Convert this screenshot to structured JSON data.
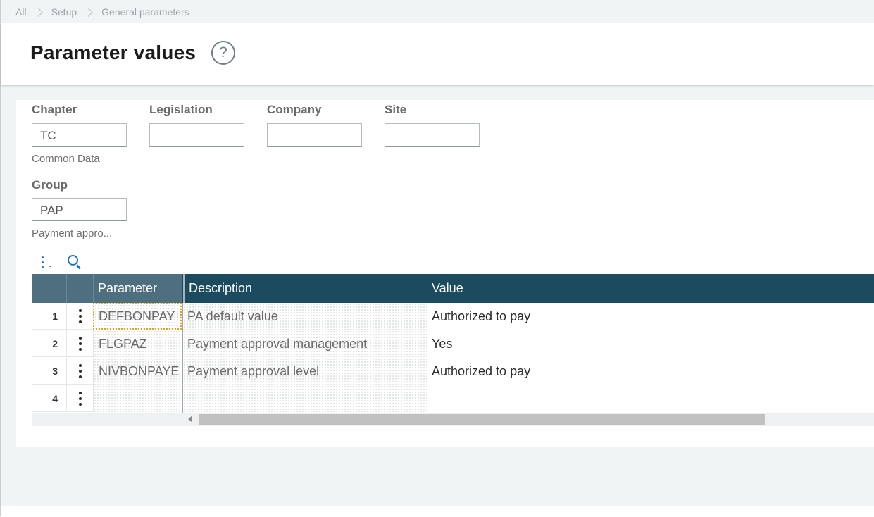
{
  "breadcrumb": {
    "items": [
      "All",
      "Setup",
      "General parameters"
    ]
  },
  "header": {
    "title": "Parameter values",
    "help_icon": "help-circle-icon",
    "help_glyph": "?"
  },
  "filters": {
    "chapter": {
      "label": "Chapter",
      "value": "TC",
      "hint": "Common Data"
    },
    "legislation": {
      "label": "Legislation",
      "value": ""
    },
    "company": {
      "label": "Company",
      "value": ""
    },
    "site": {
      "label": "Site",
      "value": ""
    },
    "group": {
      "label": "Group",
      "value": "PAP",
      "hint": "Payment appro..."
    }
  },
  "toolbar": {
    "icons": [
      "more-vertical-icon",
      "search-icon"
    ]
  },
  "grid": {
    "columns": [
      "Parameter",
      "Description",
      "Value"
    ],
    "rows": [
      {
        "num": "1",
        "parameter": "DEFBONPAY",
        "description": "PA default value",
        "value": "Authorized to pay"
      },
      {
        "num": "2",
        "parameter": "FLGPAZ",
        "description": "Payment approval management",
        "value": "Yes"
      },
      {
        "num": "3",
        "parameter": "NIVBONPAYE",
        "description": "Payment approval level",
        "value": "Authorized to pay"
      },
      {
        "num": "4",
        "parameter": "",
        "description": "",
        "value": ""
      }
    ]
  },
  "colors": {
    "header_bg": "#1c4a5f",
    "accent": "#1a73c9",
    "focus": "#e8a317"
  }
}
